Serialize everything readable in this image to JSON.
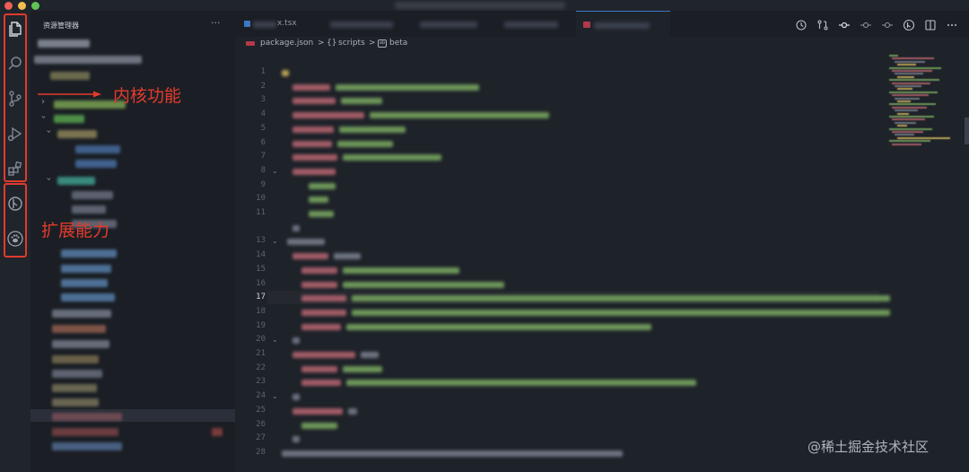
{
  "window": {
    "title": ""
  },
  "activity_bar": {
    "icons": [
      {
        "name": "files-icon",
        "active": true
      },
      {
        "name": "search-icon"
      },
      {
        "name": "source-control-icon"
      },
      {
        "name": "run-debug-icon"
      },
      {
        "name": "extensions-icon"
      },
      {
        "name": "git-graph-icon"
      },
      {
        "name": "paw-extension-icon"
      }
    ]
  },
  "annotations": {
    "core": "内核功能",
    "extension": "扩展能力",
    "color": "#e43a2c"
  },
  "sidebar": {
    "title": "资源管理器",
    "more": "···"
  },
  "tabs": [
    {
      "label": "x.tsx"
    }
  ],
  "breadcrumb": {
    "file": "package.json",
    "separator": ">",
    "scope_icon": "{}",
    "scope": "scripts",
    "item_icon": "abc-icon",
    "item": "beta"
  },
  "editor": {
    "line_numbers": [
      "1",
      "2",
      "3",
      "4",
      "5",
      "6",
      "7",
      "8",
      "9",
      "10",
      "11",
      "",
      "13",
      "14",
      "15",
      "16",
      "17",
      "18",
      "19",
      "20",
      "21",
      "22",
      "23",
      "24",
      "25",
      "26",
      "27",
      "28"
    ],
    "current_line": "17",
    "folded_lines": [
      "8",
      "13",
      "20",
      "24"
    ]
  },
  "watermark": "@稀土掘金技术社区",
  "colors": {
    "string": "#8fbf6e",
    "key": "#d26b6b",
    "accent": "#3b78c2"
  }
}
